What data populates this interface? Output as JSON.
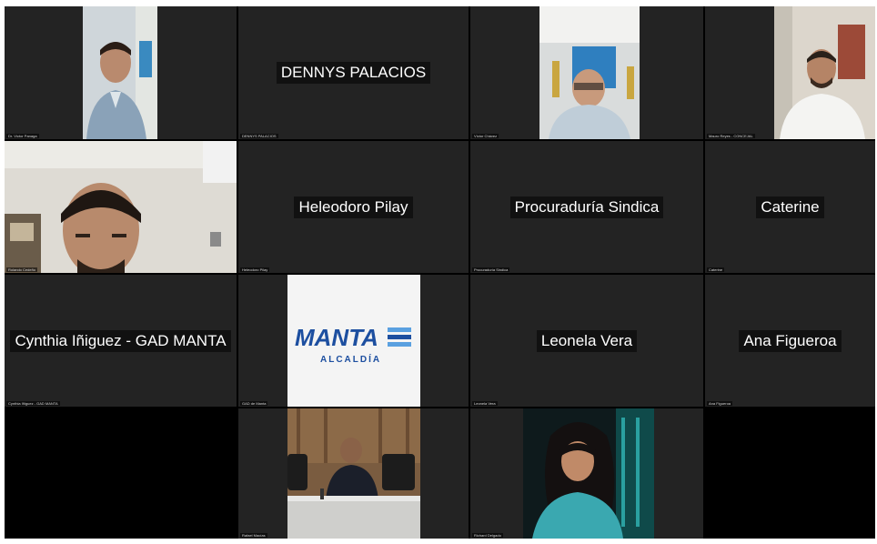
{
  "participants": [
    {
      "id": "p1",
      "label": "Dr. Víctor Panaga",
      "has_video": true
    },
    {
      "id": "p2",
      "label": "DENNYS PALACIOS",
      "display_name": "DENNYS PALACIOS",
      "has_video": false
    },
    {
      "id": "p3",
      "label": "Víctor Chávez",
      "has_video": true
    },
    {
      "id": "p4",
      "label": "Mauro Reyes - CONCEJAL",
      "has_video": true
    },
    {
      "id": "p5",
      "label": "Rolando Cedeño",
      "has_video": true
    },
    {
      "id": "p6",
      "label": "Heleodoro Pilay",
      "display_name": "Heleodoro Pilay",
      "has_video": false
    },
    {
      "id": "p7",
      "label": "Procuraduría Sindica",
      "display_name": "Procuraduría Sindica",
      "has_video": false
    },
    {
      "id": "p8",
      "label": "Caterine",
      "display_name": "Caterine",
      "has_video": false
    },
    {
      "id": "p9",
      "label": "Cynthia Iñiguez - GAD MANTA",
      "display_name": "Cynthia Iñiguez - GAD MANTA",
      "has_video": false
    },
    {
      "id": "p10",
      "label": "GAD de Manta",
      "has_video": true
    },
    {
      "id": "p11",
      "label": "Leonela Vera",
      "display_name": "Leonela Vera",
      "has_video": false
    },
    {
      "id": "p12",
      "label": "Ana Figueroa",
      "display_name": "Ana Figueroa",
      "has_video": false
    },
    {
      "id": "p13",
      "label": "Rafael Macías",
      "has_video": true
    },
    {
      "id": "p14",
      "label": "Richard Delgado",
      "has_video": true
    }
  ],
  "manta_logo": {
    "wordmark": "MANTA",
    "subtitle": "ALCALDÍA",
    "brand_color": "#1d4fa0",
    "accent_color": "#5aa0e0"
  },
  "colors": {
    "stage_background": "#000000",
    "tile_background": "#232323",
    "name_text": "#ffffff"
  }
}
